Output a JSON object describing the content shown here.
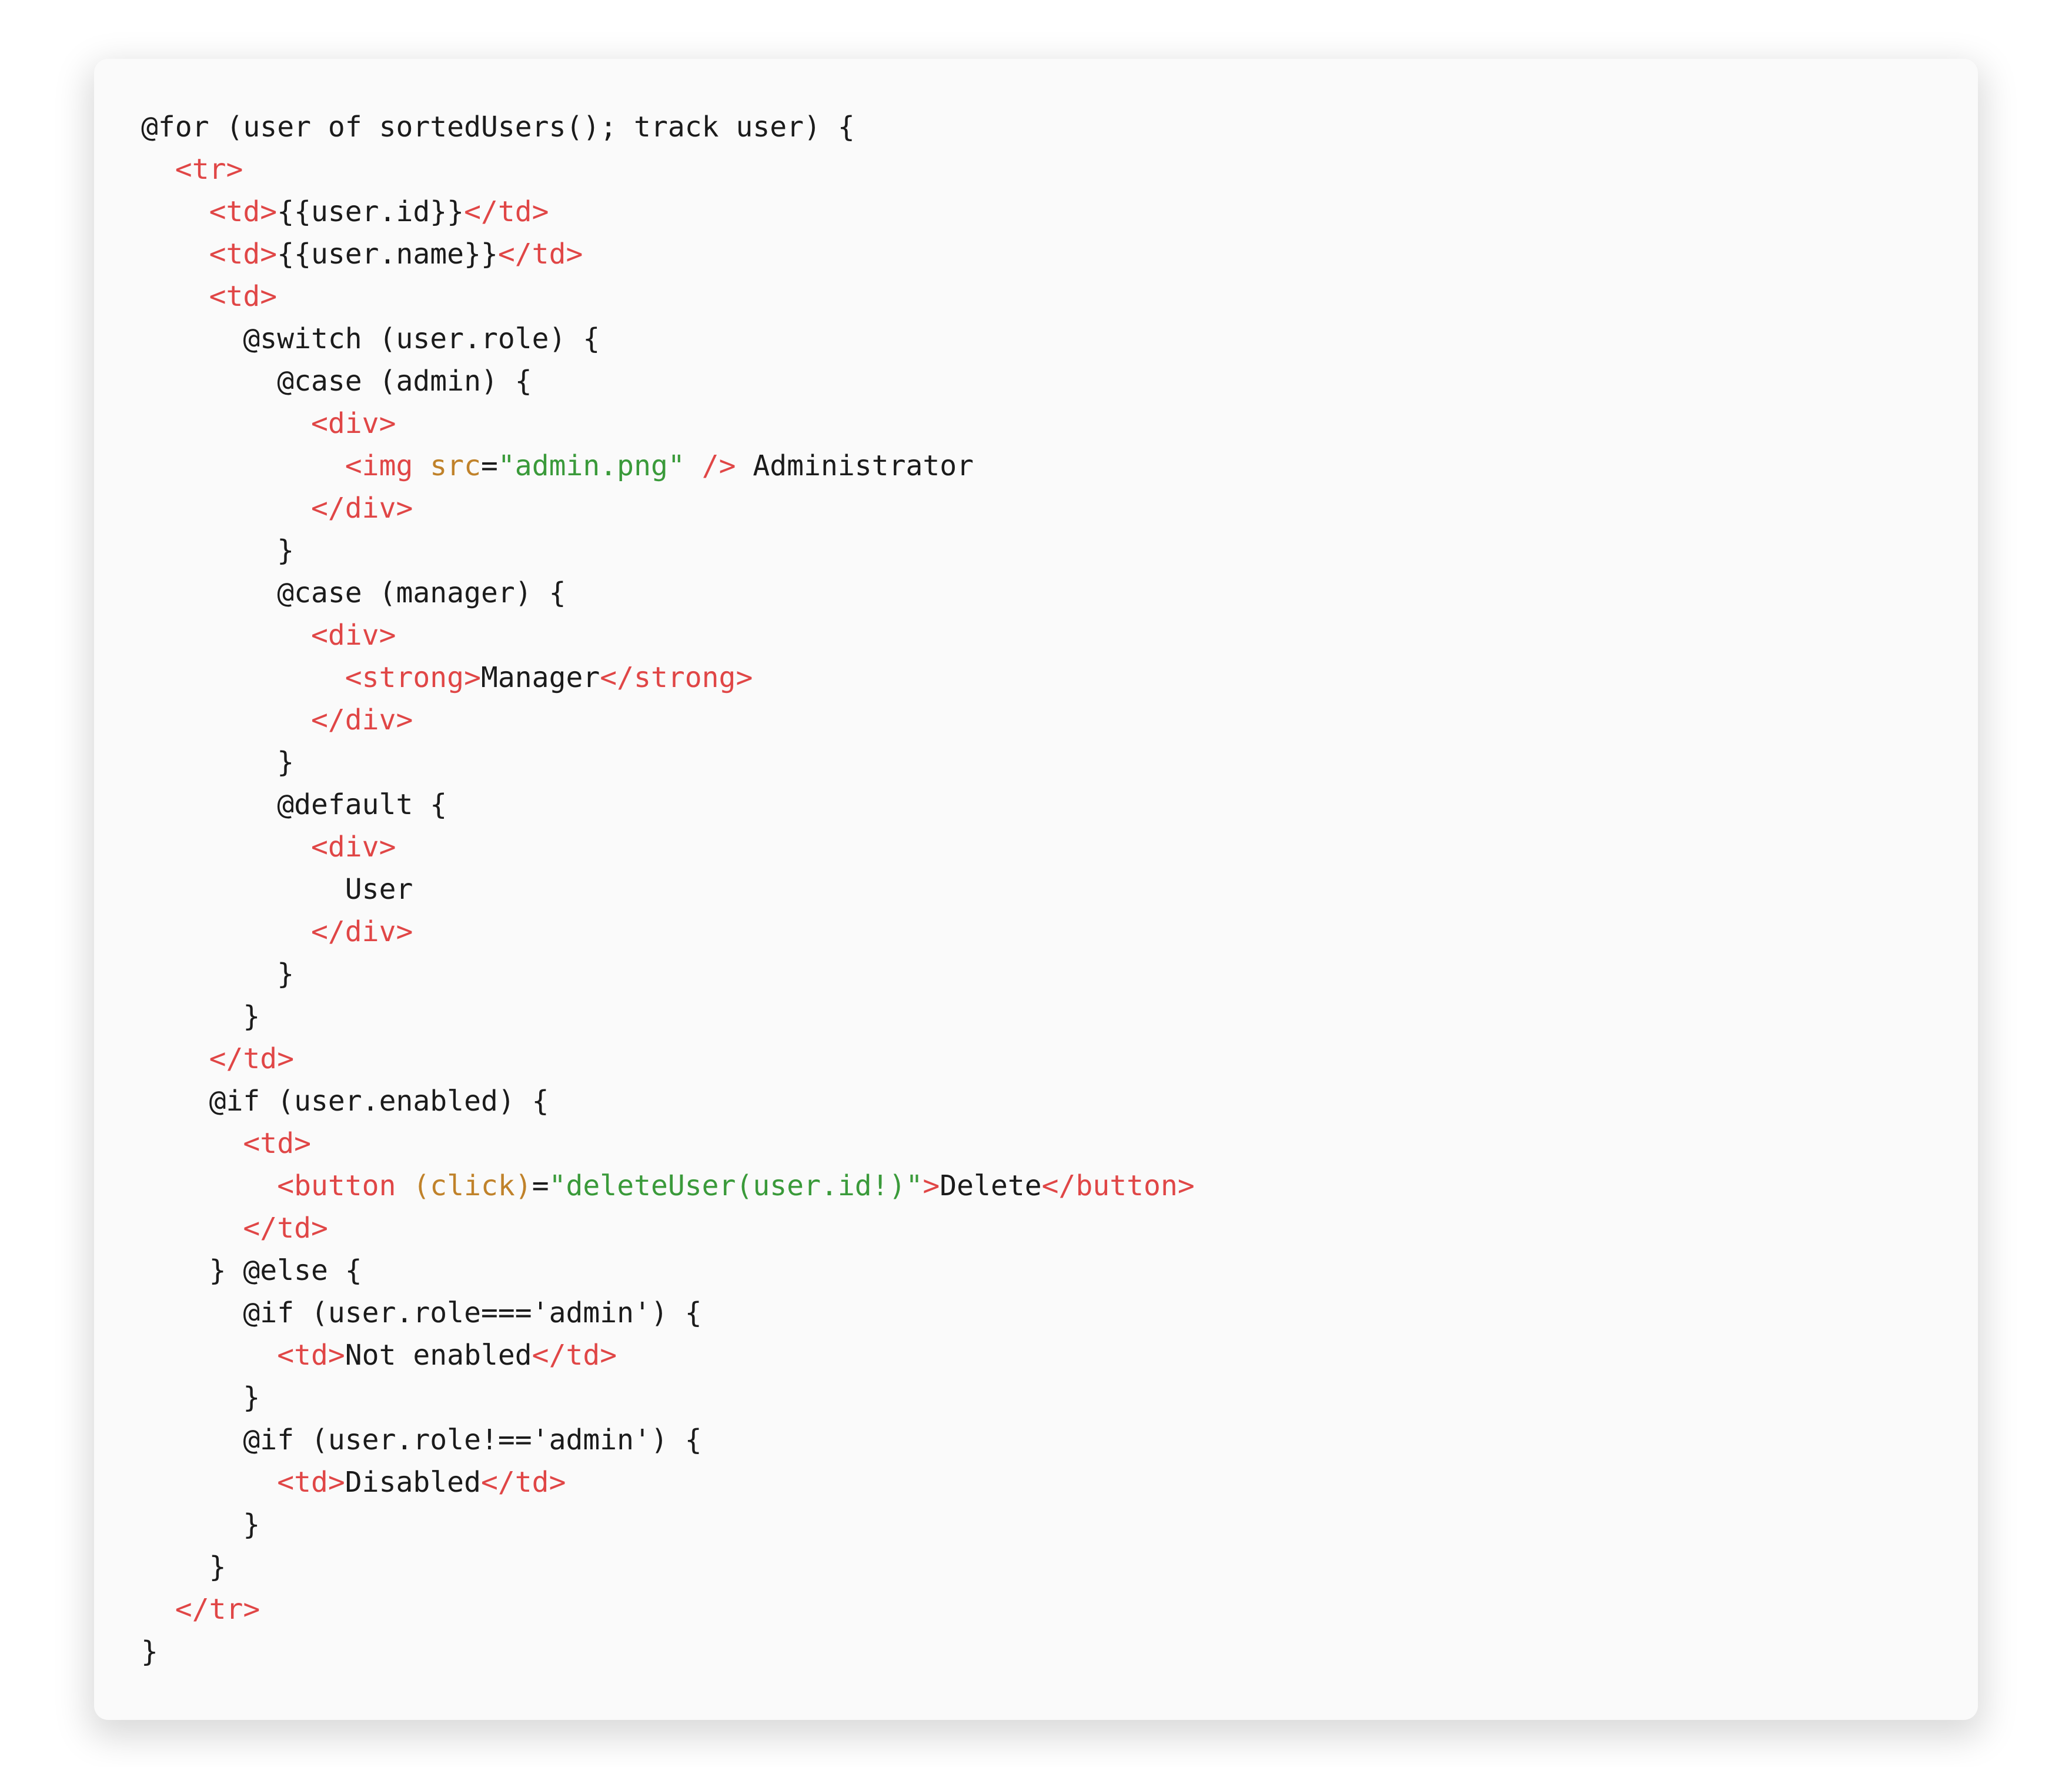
{
  "code": {
    "lines": [
      {
        "indent": 0,
        "tokens": [
          {
            "c": "plain",
            "t": "@for (user of sortedUsers(); track user) {"
          }
        ]
      },
      {
        "indent": 1,
        "tokens": [
          {
            "c": "tag",
            "t": "<tr>"
          }
        ]
      },
      {
        "indent": 2,
        "tokens": [
          {
            "c": "tag",
            "t": "<td>"
          },
          {
            "c": "plain",
            "t": "{{user.id}}"
          },
          {
            "c": "tag",
            "t": "</td>"
          }
        ]
      },
      {
        "indent": 2,
        "tokens": [
          {
            "c": "tag",
            "t": "<td>"
          },
          {
            "c": "plain",
            "t": "{{user.name}}"
          },
          {
            "c": "tag",
            "t": "</td>"
          }
        ]
      },
      {
        "indent": 2,
        "tokens": [
          {
            "c": "tag",
            "t": "<td>"
          }
        ]
      },
      {
        "indent": 3,
        "tokens": [
          {
            "c": "plain",
            "t": "@switch (user.role) {"
          }
        ]
      },
      {
        "indent": 4,
        "tokens": [
          {
            "c": "plain",
            "t": "@case (admin) {"
          }
        ]
      },
      {
        "indent": 5,
        "tokens": [
          {
            "c": "tag",
            "t": "<div>"
          }
        ]
      },
      {
        "indent": 6,
        "tokens": [
          {
            "c": "tag",
            "t": "<img"
          },
          {
            "c": "plain",
            "t": " "
          },
          {
            "c": "attr",
            "t": "src"
          },
          {
            "c": "plain",
            "t": "="
          },
          {
            "c": "string",
            "t": "\"admin.png\""
          },
          {
            "c": "plain",
            "t": " "
          },
          {
            "c": "tag",
            "t": "/>"
          },
          {
            "c": "plain",
            "t": " Administrator"
          }
        ]
      },
      {
        "indent": 5,
        "tokens": [
          {
            "c": "tag",
            "t": "</div>"
          }
        ]
      },
      {
        "indent": 4,
        "tokens": [
          {
            "c": "plain",
            "t": "}"
          }
        ]
      },
      {
        "indent": 4,
        "tokens": [
          {
            "c": "plain",
            "t": "@case (manager) {"
          }
        ]
      },
      {
        "indent": 5,
        "tokens": [
          {
            "c": "tag",
            "t": "<div>"
          }
        ]
      },
      {
        "indent": 6,
        "tokens": [
          {
            "c": "tag",
            "t": "<strong>"
          },
          {
            "c": "plain",
            "t": "Manager"
          },
          {
            "c": "tag",
            "t": "</strong>"
          }
        ]
      },
      {
        "indent": 5,
        "tokens": [
          {
            "c": "tag",
            "t": "</div>"
          }
        ]
      },
      {
        "indent": 4,
        "tokens": [
          {
            "c": "plain",
            "t": "}"
          }
        ]
      },
      {
        "indent": 4,
        "tokens": [
          {
            "c": "plain",
            "t": "@default {"
          }
        ]
      },
      {
        "indent": 5,
        "tokens": [
          {
            "c": "tag",
            "t": "<div>"
          }
        ]
      },
      {
        "indent": 6,
        "tokens": [
          {
            "c": "plain",
            "t": "User"
          }
        ]
      },
      {
        "indent": 5,
        "tokens": [
          {
            "c": "tag",
            "t": "</div>"
          }
        ]
      },
      {
        "indent": 4,
        "tokens": [
          {
            "c": "plain",
            "t": "}"
          }
        ]
      },
      {
        "indent": 3,
        "tokens": [
          {
            "c": "plain",
            "t": "}"
          }
        ]
      },
      {
        "indent": 2,
        "tokens": [
          {
            "c": "tag",
            "t": "</td>"
          }
        ]
      },
      {
        "indent": 2,
        "tokens": [
          {
            "c": "plain",
            "t": "@if (user.enabled) {"
          }
        ]
      },
      {
        "indent": 3,
        "tokens": [
          {
            "c": "tag",
            "t": "<td>"
          }
        ]
      },
      {
        "indent": 4,
        "tokens": [
          {
            "c": "tag",
            "t": "<button"
          },
          {
            "c": "plain",
            "t": " "
          },
          {
            "c": "attr",
            "t": "(click)"
          },
          {
            "c": "plain",
            "t": "="
          },
          {
            "c": "string",
            "t": "\"deleteUser(user.id!)\""
          },
          {
            "c": "tag",
            "t": ">"
          },
          {
            "c": "plain",
            "t": "Delete"
          },
          {
            "c": "tag",
            "t": "</button>"
          }
        ]
      },
      {
        "indent": 3,
        "tokens": [
          {
            "c": "tag",
            "t": "</td>"
          }
        ]
      },
      {
        "indent": 2,
        "tokens": [
          {
            "c": "plain",
            "t": "} @else {"
          }
        ]
      },
      {
        "indent": 3,
        "tokens": [
          {
            "c": "plain",
            "t": "@if (user.role==='admin') {"
          }
        ]
      },
      {
        "indent": 4,
        "tokens": [
          {
            "c": "tag",
            "t": "<td>"
          },
          {
            "c": "plain",
            "t": "Not enabled"
          },
          {
            "c": "tag",
            "t": "</td>"
          }
        ]
      },
      {
        "indent": 3,
        "tokens": [
          {
            "c": "plain",
            "t": "}"
          }
        ]
      },
      {
        "indent": 3,
        "tokens": [
          {
            "c": "plain",
            "t": "@if (user.role!=='admin') {"
          }
        ]
      },
      {
        "indent": 4,
        "tokens": [
          {
            "c": "tag",
            "t": "<td>"
          },
          {
            "c": "plain",
            "t": "Disabled"
          },
          {
            "c": "tag",
            "t": "</td>"
          }
        ]
      },
      {
        "indent": 3,
        "tokens": [
          {
            "c": "plain",
            "t": "}"
          }
        ]
      },
      {
        "indent": 2,
        "tokens": [
          {
            "c": "plain",
            "t": "}"
          }
        ]
      },
      {
        "indent": 1,
        "tokens": [
          {
            "c": "tag",
            "t": "</tr>"
          }
        ]
      },
      {
        "indent": 0,
        "tokens": [
          {
            "c": "plain",
            "t": "}"
          }
        ]
      }
    ],
    "indent_unit": "  "
  },
  "colors": {
    "tag": "#e04646",
    "attr": "#c0822a",
    "string": "#3a9a3a",
    "plain": "#1b1b1b",
    "card_bg": "#fafafa"
  }
}
